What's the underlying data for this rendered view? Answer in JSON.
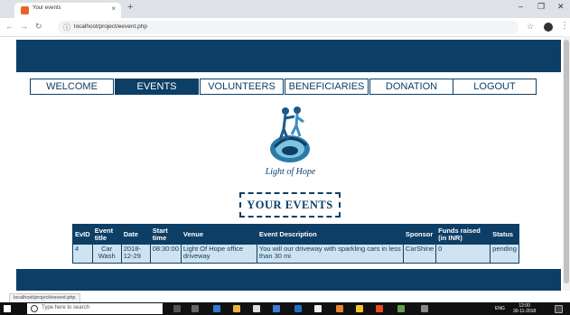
{
  "browser": {
    "tab_title": "Your events",
    "url": "localhost/project/eevent.php",
    "status_url": "localhost/project/eevent.php"
  },
  "nav": [
    "WELCOME",
    "EVENTS",
    "VOLUNTEERS",
    "BENEFICIARIES",
    "DONATION",
    "LOGOUT"
  ],
  "logo_text": "Light of Hope",
  "heading": "YOUR EVENTS",
  "table": {
    "headers": [
      "EvID",
      "Event title",
      "Date",
      "Start time",
      "Venue",
      "Event Description",
      "Sponsor",
      "Funds raised (in INR)",
      "Status"
    ],
    "rows": [
      [
        "4",
        "Car Wash",
        "2018-12-29",
        "08:30:00",
        "Light Of Hope office driveway",
        "You will our driveway with sparkling cars in less than 30 mi",
        "CarShine",
        "0",
        "pending"
      ]
    ]
  },
  "taskbar": {
    "search_placeholder": "Type here to search",
    "time": "12:00",
    "date": "30-11-2018",
    "lang": "ENG"
  },
  "colors": {
    "primary": "#0d3e66",
    "row_bg": "#cfe2ef"
  }
}
